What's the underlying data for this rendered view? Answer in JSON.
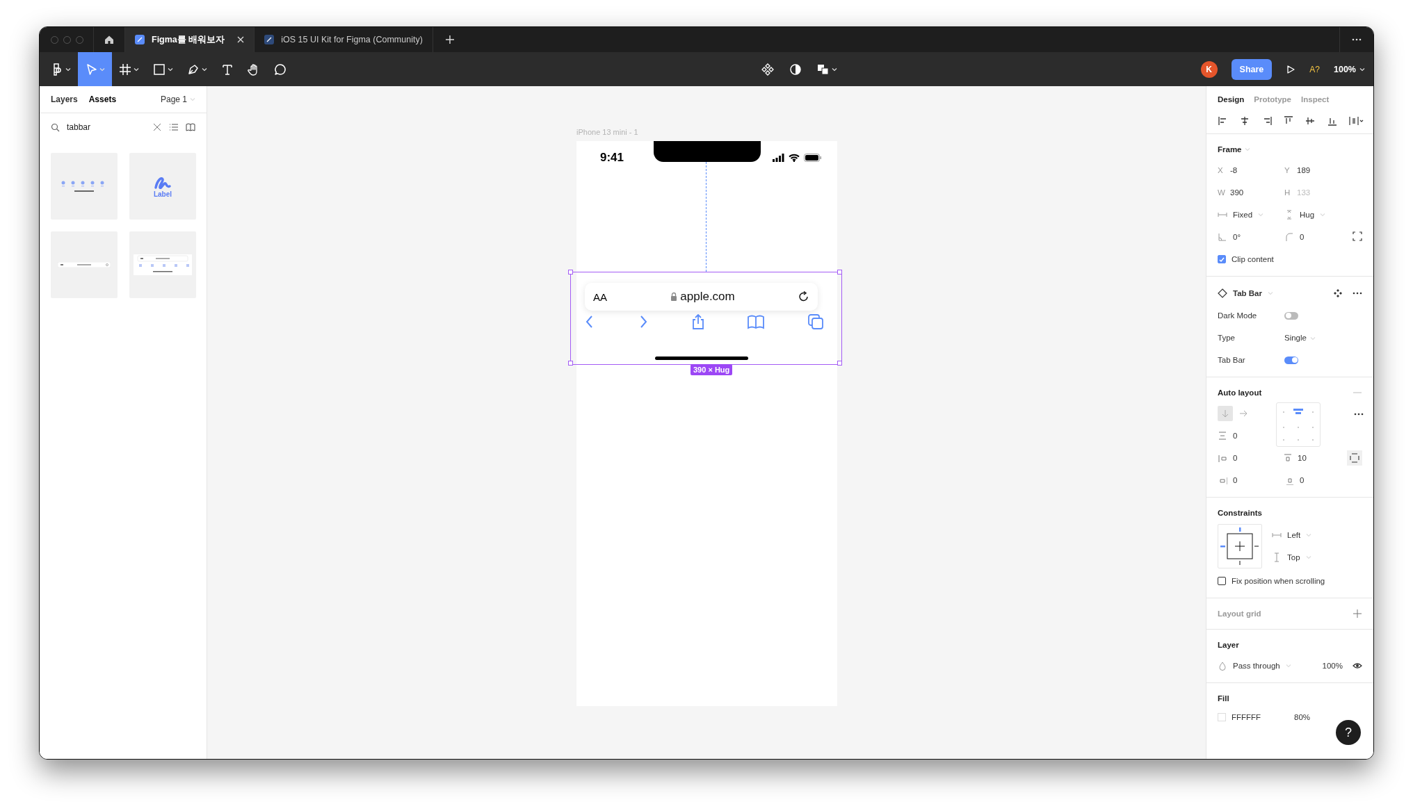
{
  "window": {
    "tabs": [
      {
        "label": "Figma를 배워보자",
        "selected": true
      },
      {
        "label": "iOS 15 UI Kit for Figma (Community)",
        "selected": false
      }
    ]
  },
  "toolbar": {
    "tools": [
      {
        "kind": "main-menu",
        "selected": false
      },
      {
        "kind": "move",
        "selected": true
      },
      {
        "kind": "frame",
        "selected": false
      },
      {
        "kind": "shape",
        "selected": false
      },
      {
        "kind": "pen",
        "selected": false
      },
      {
        "kind": "text",
        "selected": false
      },
      {
        "kind": "hand",
        "selected": false
      },
      {
        "kind": "comment",
        "selected": false
      }
    ],
    "center_tools": [
      {
        "kind": "component"
      },
      {
        "kind": "mask"
      },
      {
        "kind": "boolean"
      }
    ],
    "avatar": "K",
    "share": "Share",
    "font_warning": "A?",
    "zoom": "100%"
  },
  "left_panel": {
    "tabs": [
      {
        "label": "Layers",
        "selected": false
      },
      {
        "label": "Assets",
        "selected": true
      }
    ],
    "page": "Page 1",
    "search": {
      "value": "tabbar"
    },
    "assets": [
      {
        "kind": "tab-icons"
      },
      {
        "kind": "label-icon",
        "label": "Label"
      },
      {
        "kind": "url-bar"
      },
      {
        "kind": "browser-bar"
      }
    ]
  },
  "canvas": {
    "frame": {
      "title": "iPhone 13 mini - 1",
      "time": "9:41",
      "text_size": "AA",
      "url": "apple.com",
      "size": "390 × Hug"
    }
  },
  "right_panel": {
    "tabs": [
      {
        "label": "Design",
        "selected": true
      },
      {
        "label": "Prototype",
        "selected": false
      },
      {
        "label": "Inspect",
        "selected": false
      }
    ],
    "frame": {
      "title": "Frame",
      "fields": [
        {
          "label": "X",
          "value": "-8",
          "disabled": false
        },
        {
          "label": "Y",
          "value": "189",
          "disabled": false
        },
        {
          "label": "W",
          "value": "390",
          "disabled": false
        },
        {
          "label": "H",
          "value": "133",
          "disabled": true
        }
      ],
      "sizing": [
        {
          "kind": "width",
          "value": "Fixed"
        },
        {
          "kind": "height",
          "value": "Hug"
        }
      ],
      "rotation": "0°",
      "radius": "0",
      "clip": {
        "label": "Clip content",
        "checked": true
      }
    },
    "component": {
      "name": "Tab Bar",
      "props": [
        {
          "kind": "toggle",
          "label": "Dark Mode",
          "on": false
        },
        {
          "kind": "dropdown",
          "label": "Type",
          "value": "Single"
        },
        {
          "kind": "toggle",
          "label": "Tab Bar",
          "on": true
        }
      ]
    },
    "auto_layout": {
      "title": "Auto layout",
      "directions": [
        {
          "kind": "vertical",
          "selected": true
        },
        {
          "kind": "horizontal",
          "selected": false
        }
      ],
      "alignment": [
        {
          "selected": false
        },
        {
          "selected": true
        },
        {
          "selected": false
        },
        {
          "selected": false
        },
        {
          "selected": false
        },
        {
          "selected": false
        },
        {
          "selected": false
        },
        {
          "selected": false
        },
        {
          "selected": false
        }
      ],
      "spacing": "0",
      "padding": [
        {
          "kind": "left",
          "value": "0"
        },
        {
          "kind": "top",
          "value": "10"
        },
        {
          "kind": "right",
          "value": "0"
        },
        {
          "kind": "bottom",
          "value": "0"
        }
      ]
    },
    "constraints": {
      "title": "Constraints",
      "horizontal": "Left",
      "vertical": "Top",
      "fix_position": {
        "label": "Fix position when scrolling",
        "checked": false
      }
    },
    "layout_grid": {
      "title": "Layout grid"
    },
    "layer": {
      "title": "Layer",
      "blend": "Pass through",
      "opacity": "100%"
    },
    "fill": {
      "title": "Fill",
      "hex": "FFFFFF",
      "opacity": "80%"
    }
  },
  "help": "?"
}
